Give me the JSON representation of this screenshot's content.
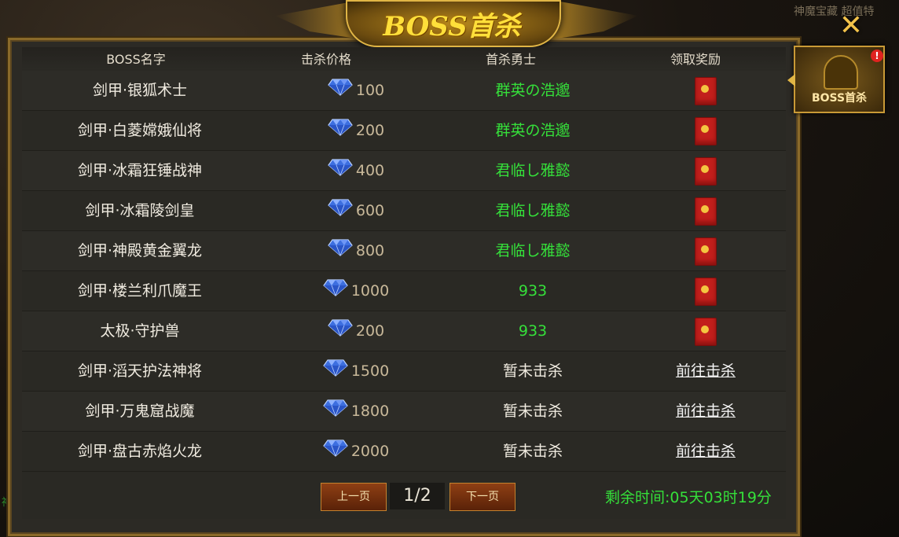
{
  "window": {
    "title": "BOSS首杀",
    "top_right_text": "神魔宝藏  超值特",
    "side_tab_label": "BOSS首杀",
    "side_tab_badge": "!",
    "side_char": "神"
  },
  "columns": {
    "name": "BOSS名字",
    "price": "击杀价格",
    "hero": "首杀勇士",
    "reward": "领取奖励"
  },
  "rows": [
    {
      "name": "剑甲·银狐术士",
      "price": "100",
      "hero": "群英の浩邈",
      "hero_color": "#35e03a",
      "reward": "redpack"
    },
    {
      "name": "剑甲·白菱嫦娥仙将",
      "price": "200",
      "hero": "群英の浩邈",
      "hero_color": "#35e03a",
      "reward": "redpack"
    },
    {
      "name": "剑甲·冰霜狂锤战神",
      "price": "400",
      "hero": "君临し雅懿",
      "hero_color": "#35e03a",
      "reward": "redpack"
    },
    {
      "name": "剑甲·冰霜陵剑皇",
      "price": "600",
      "hero": "君临し雅懿",
      "hero_color": "#35e03a",
      "reward": "redpack"
    },
    {
      "name": "剑甲·神殿黄金翼龙",
      "price": "800",
      "hero": "君临し雅懿",
      "hero_color": "#35e03a",
      "reward": "redpack"
    },
    {
      "name": "剑甲·楼兰利爪魔王",
      "price": "1000",
      "hero": "933",
      "hero_color": "#35e03a",
      "reward": "redpack"
    },
    {
      "name": "太极·守护兽",
      "price": "200",
      "hero": "933",
      "hero_color": "#35e03a",
      "reward": "redpack"
    },
    {
      "name": "剑甲·滔天护法神将",
      "price": "1500",
      "hero": "暂未击杀",
      "hero_color": "#f0ebe0",
      "reward": "link",
      "reward_text": "前往击杀"
    },
    {
      "name": "剑甲·万鬼窟战魔",
      "price": "1800",
      "hero": "暂未击杀",
      "hero_color": "#f0ebe0",
      "reward": "link",
      "reward_text": "前往击杀"
    },
    {
      "name": "剑甲·盘古赤焰火龙",
      "price": "2000",
      "hero": "暂未击杀",
      "hero_color": "#f0ebe0",
      "reward": "link",
      "reward_text": "前往击杀"
    }
  ],
  "pagination": {
    "prev": "上一页",
    "next": "下一页",
    "current": "1/2"
  },
  "remaining_time": "剩余时间:05天03时19分",
  "colors": {
    "accent_gold": "#e0b545",
    "hero_green": "#35e03a",
    "redpack": "#c21f1c"
  }
}
